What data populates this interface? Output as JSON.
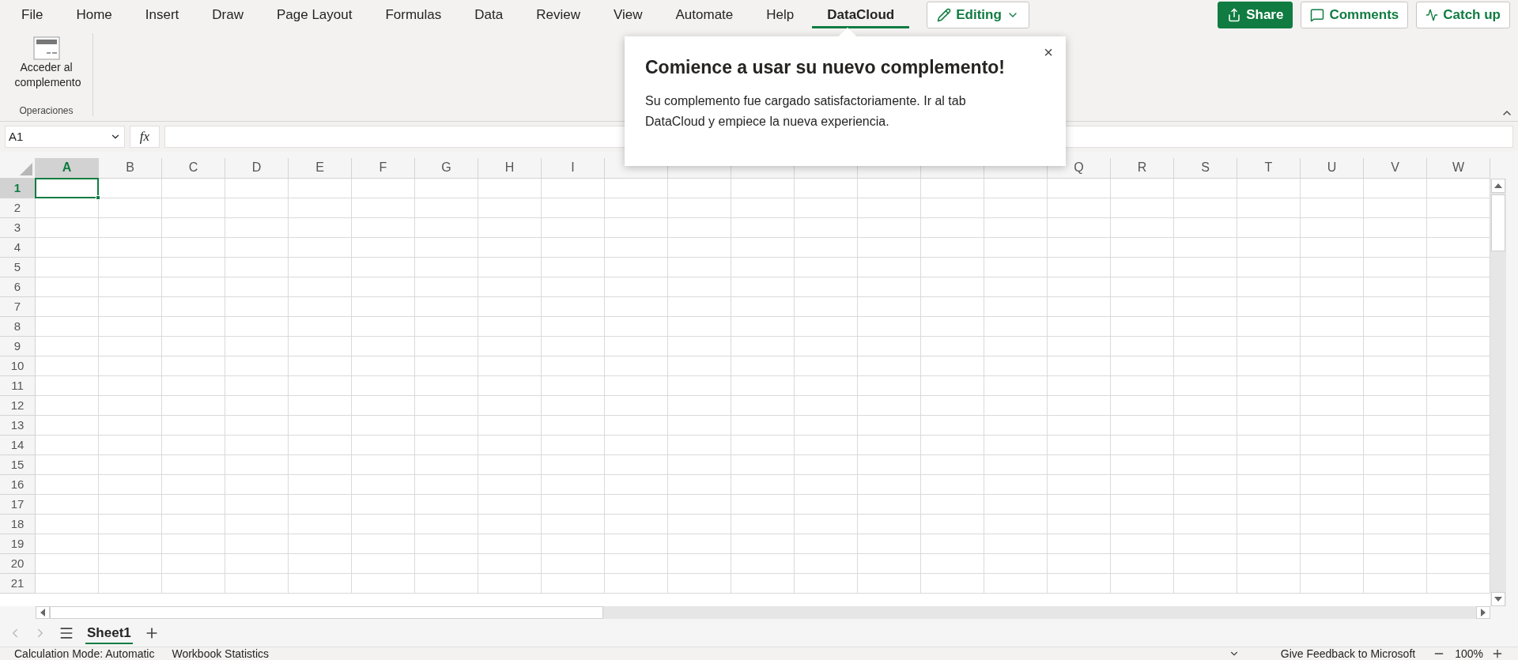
{
  "menu_tabs": [
    {
      "label": "File",
      "selected": false
    },
    {
      "label": "Home",
      "selected": false
    },
    {
      "label": "Insert",
      "selected": false
    },
    {
      "label": "Draw",
      "selected": false
    },
    {
      "label": "Page Layout",
      "selected": false
    },
    {
      "label": "Formulas",
      "selected": false
    },
    {
      "label": "Data",
      "selected": false
    },
    {
      "label": "Review",
      "selected": false
    },
    {
      "label": "View",
      "selected": false
    },
    {
      "label": "Automate",
      "selected": false
    },
    {
      "label": "Help",
      "selected": false
    },
    {
      "label": "DataCloud",
      "selected": true
    }
  ],
  "mode_button": {
    "label": "Editing"
  },
  "actions": [
    {
      "label": "Share",
      "kind": "primary"
    },
    {
      "label": "Comments",
      "kind": "comment"
    },
    {
      "label": "Catch up",
      "kind": "activity"
    }
  ],
  "ribbon": {
    "button": {
      "label": "Acceder al complemento"
    },
    "group_label": "Operaciones"
  },
  "name_box": {
    "value": "A1"
  },
  "formula_label": "fx",
  "popup": {
    "title": "Comience a usar su nuevo complemento!",
    "body": "Su complemento fue cargado satisfactoriamente. Ir al tab DataCloud y empiece la nueva experiencia.",
    "close": "×"
  },
  "columns": [
    {
      "label": "A",
      "selected": true
    },
    {
      "label": "B",
      "selected": false
    },
    {
      "label": "C",
      "selected": false
    },
    {
      "label": "D",
      "selected": false
    },
    {
      "label": "E",
      "selected": false
    },
    {
      "label": "F",
      "selected": false
    },
    {
      "label": "G",
      "selected": false
    },
    {
      "label": "H",
      "selected": false
    },
    {
      "label": "I",
      "selected": false
    },
    {
      "selected": false
    },
    {
      "selected": false
    },
    {
      "selected": false
    },
    {
      "selected": false
    },
    {
      "selected": false
    },
    {
      "selected": false
    },
    {
      "selected": false
    },
    {
      "label": "Q",
      "selected": false
    },
    {
      "label": "R",
      "selected": false
    },
    {
      "label": "S",
      "selected": false
    },
    {
      "label": "T",
      "selected": false
    },
    {
      "label": "U",
      "selected": false
    },
    {
      "label": "V",
      "selected": false
    },
    {
      "label": "W",
      "selected": false
    }
  ],
  "rows": [
    {
      "label": "1",
      "selected": true
    },
    {
      "label": "2",
      "selected": false
    },
    {
      "label": "3",
      "selected": false
    },
    {
      "label": "4",
      "selected": false
    },
    {
      "label": "5",
      "selected": false
    },
    {
      "label": "6",
      "selected": false
    },
    {
      "label": "7",
      "selected": false
    },
    {
      "label": "8",
      "selected": false
    },
    {
      "label": "9",
      "selected": false
    },
    {
      "label": "10",
      "selected": false
    },
    {
      "label": "11",
      "selected": false
    },
    {
      "label": "12",
      "selected": false
    },
    {
      "label": "13",
      "selected": false
    },
    {
      "label": "14",
      "selected": false
    },
    {
      "label": "15",
      "selected": false
    },
    {
      "label": "16",
      "selected": false
    },
    {
      "label": "17",
      "selected": false
    },
    {
      "label": "18",
      "selected": false
    },
    {
      "label": "19",
      "selected": false
    },
    {
      "label": "20",
      "selected": false
    },
    {
      "label": "21",
      "selected": false
    }
  ],
  "sheets": [
    {
      "label": "Sheet1",
      "selected": true
    }
  ],
  "status_bar": {
    "left": [
      "Calculation Mode: Automatic",
      "Workbook Statistics"
    ],
    "feedback": "Give Feedback to Microsoft",
    "zoom": "100%"
  }
}
